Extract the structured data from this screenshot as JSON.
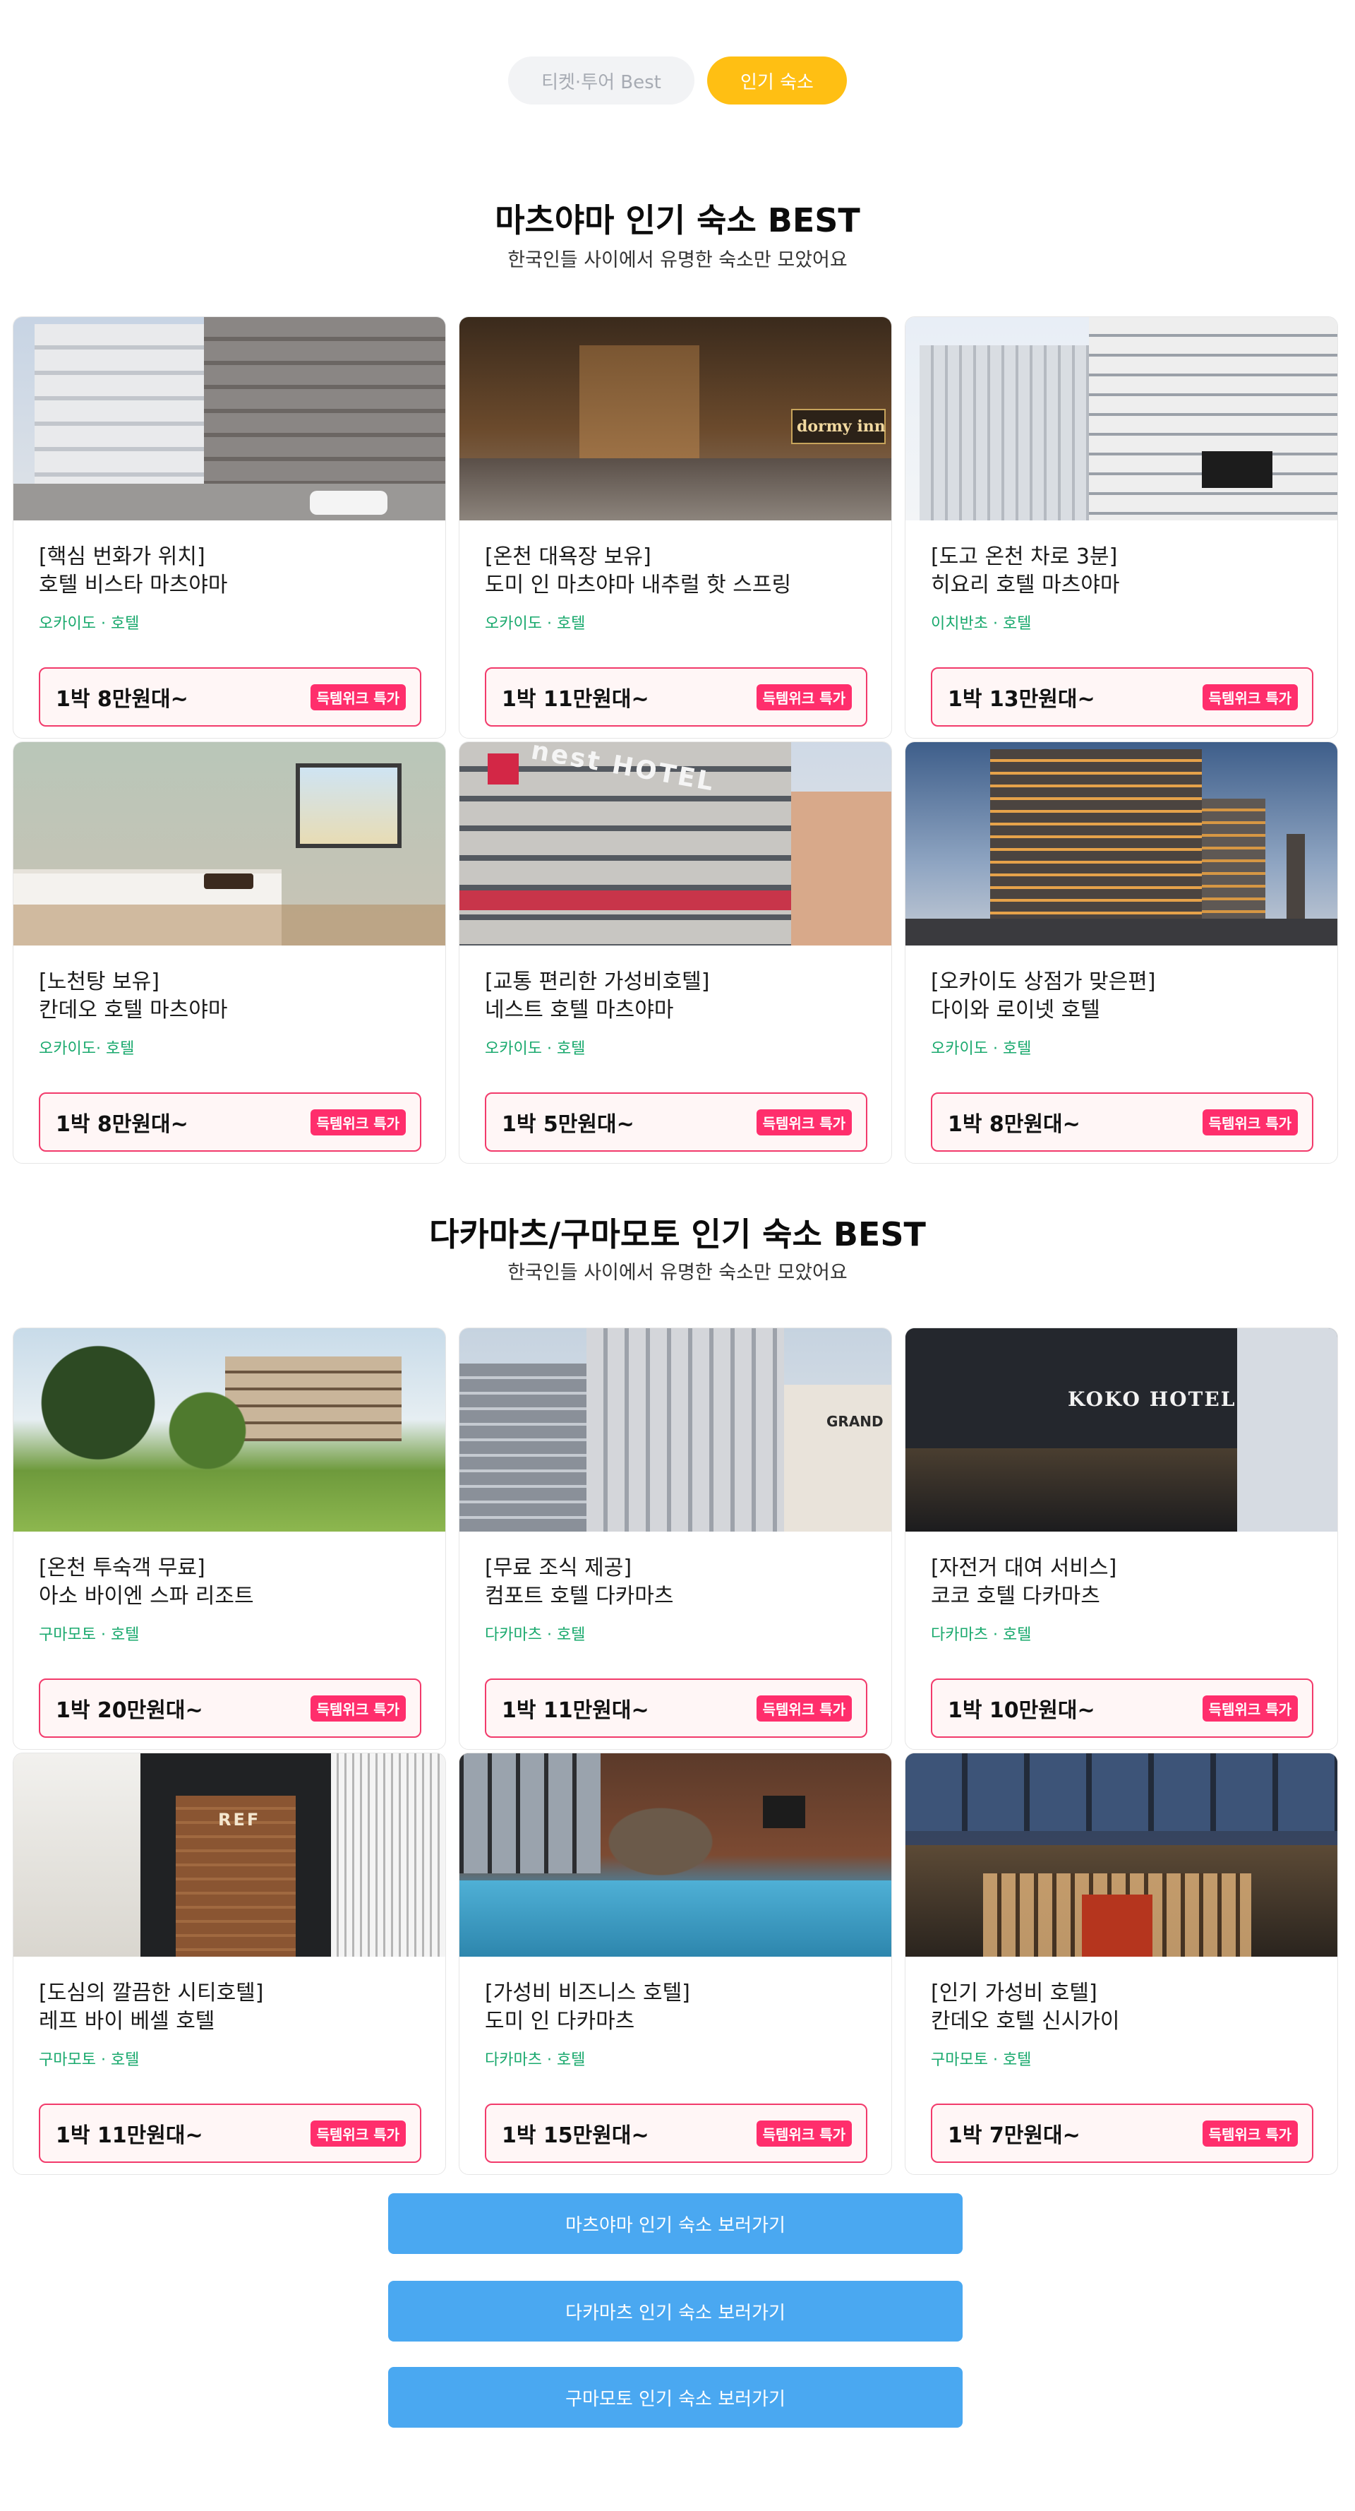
{
  "tabs": [
    {
      "label": "티켓·투어 Best"
    },
    {
      "label": "인기 숙소"
    }
  ],
  "colors": {
    "accent_tab": "#ffbf13",
    "location": "#19a96d",
    "deal": "#ff2e6c",
    "price_border": "#f23a6b",
    "button": "#4aa8f1"
  },
  "sections": [
    {
      "title": "마츠야마 인기 숙소 BEST",
      "subtitle": "한국인들 사이에서 유명한 숙소만 모았어요",
      "cards": [
        {
          "tag": "[핵심 번화가 위치]",
          "name": "호텔 비스타 마츠야마",
          "location": "오카이도 · 호텔",
          "price": "1박 8만원대~",
          "deal": "득템위크 특가"
        },
        {
          "tag": "[온천 대욕장 보유]",
          "name": "도미 인 마츠야마 내추럴 핫 스프링",
          "location": "오카이도 · 호텔",
          "price": "1박 11만원대~",
          "deal": "득템위크 특가",
          "image_text": "dormy inn"
        },
        {
          "tag": "[도고 온천 차로 3분]",
          "name": "히요리 호텔 마츠야마",
          "location": "이치반초 · 호텔",
          "price": "1박 13만원대~",
          "deal": "득템위크 특가"
        },
        {
          "tag": "[노천탕 보유]",
          "name": "칸데오 호텔 마츠야마",
          "location": "오카이도· 호텔",
          "price": "1박 8만원대~",
          "deal": "득템위크 특가"
        },
        {
          "tag": "[교통 편리한 가성비호텔]",
          "name": "네스트 호텔 마츠야마",
          "location": "오카이도 · 호텔",
          "price": "1박 5만원대~",
          "deal": "득템위크 특가",
          "image_text": "nest HOTEL"
        },
        {
          "tag": "[오카이도 상점가 맞은편]",
          "name": "다이와 로이넷 호텔",
          "location": "오카이도 · 호텔",
          "price": "1박 8만원대~",
          "deal": "득템위크 특가"
        }
      ]
    },
    {
      "title": "다카마츠/구마모토 인기 숙소 BEST",
      "subtitle": "한국인들 사이에서 유명한 숙소만 모았어요",
      "cards": [
        {
          "tag": "[온천 투숙객 무료]",
          "name": "아소 바이엔 스파 리조트",
          "location": "구마모토 · 호텔",
          "price": "1박 20만원대~",
          "deal": "득템위크 특가"
        },
        {
          "tag": "[무료 조식 제공]",
          "name": "컴포트 호텔 다카마츠",
          "location": "다카마츠 · 호텔",
          "price": "1박 11만원대~",
          "deal": "득템위크 특가",
          "image_text": "GRAND"
        },
        {
          "tag": "[자전거 대여 서비스]",
          "name": "코코 호텔 다카마츠",
          "location": "다카마츠 · 호텔",
          "price": "1박 10만원대~",
          "deal": "득템위크 특가",
          "image_text": "KOKO HOTEL"
        },
        {
          "tag": "[도심의 깔끔한 시티호텔]",
          "name": "레프 바이 베셀 호텔",
          "location": "구마모토 · 호텔",
          "price": "1박 11만원대~",
          "deal": "득템위크 특가",
          "image_text": "REF"
        },
        {
          "tag": "[가성비 비즈니스 호텔]",
          "name": "도미 인 다카마츠",
          "location": "다카마츠 · 호텔",
          "price": "1박 15만원대~",
          "deal": "득템위크 특가"
        },
        {
          "tag": "[인기 가성비 호텔]",
          "name": "칸데오 호텔 신시가이",
          "location": "구마모토 · 호텔",
          "price": "1박 7만원대~",
          "deal": "득템위크 특가"
        }
      ]
    }
  ],
  "buttons": [
    {
      "label": "마츠야마  인기 숙소 보러가기"
    },
    {
      "label": "다카마츠  인기 숙소 보러가기"
    },
    {
      "label": "구마모토  인기 숙소 보러가기"
    }
  ]
}
